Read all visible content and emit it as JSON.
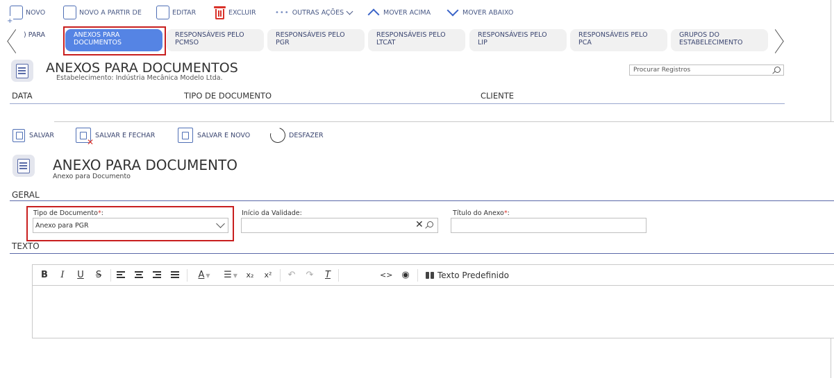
{
  "toolbar": {
    "novo": "NOVO",
    "novo_partir": "NOVO A PARTIR DE",
    "editar": "EDITAR",
    "excluir": "EXCLUIR",
    "outras_acoes": "OUTRAS AÇÕES",
    "mover_acima": "MOVER ACIMA",
    "mover_abaixo": "MOVER ABAIXO"
  },
  "tabs": [
    {
      "line1": ") PARA",
      "line2": "",
      "active": false
    },
    {
      "line1": "ANEXOS PARA",
      "line2": "DOCUMENTOS",
      "active": true
    },
    {
      "line1": "RESPONSÁVEIS PELO",
      "line2": "PCMSO",
      "active": false
    },
    {
      "line1": "RESPONSÁVEIS PELO",
      "line2": "PGR",
      "active": false
    },
    {
      "line1": "RESPONSÁVEIS PELO",
      "line2": "LTCAT",
      "active": false
    },
    {
      "line1": "RESPONSÁVEIS PELO",
      "line2": "LIP",
      "active": false
    },
    {
      "line1": "RESPONSÁVEIS PELO",
      "line2": "PCA",
      "active": false
    },
    {
      "line1": "GRUPOS DO",
      "line2": "ESTABELECIMENTO",
      "active": false
    }
  ],
  "list": {
    "title": "ANEXOS PARA DOCUMENTOS",
    "subtitle": "Estabelecimento: Indústria Mecânica Modelo Ltda.",
    "search_placeholder": "Procurar Registros",
    "columns": [
      "DATA",
      "TIPO DE DOCUMENTO",
      "CLIENTE"
    ]
  },
  "form_toolbar": {
    "salvar": "SALVAR",
    "salvar_fechar": "SALVAR E FECHAR",
    "salvar_novo": "SALVAR E NOVO",
    "desfazer": "DESFAZER"
  },
  "form": {
    "title": "ANEXO PARA DOCUMENTO",
    "subtitle": "Anexo para Documento",
    "section_geral": "GERAL",
    "section_texto": "TEXTO",
    "required_mark": "*",
    "tipo_label": "Tipo de Documento",
    "tipo_value": "Anexo para PGR",
    "inicio_label": "Início da Validade:",
    "titulo_label": "Título do Anexo",
    "colon": ":",
    "inicio_value": "",
    "titulo_value": ""
  },
  "editor": {
    "bold": "B",
    "italic": "I",
    "underline": "U",
    "strike": "S",
    "predefined": "Texto Predefinido",
    "content": ""
  },
  "colors": {
    "accent": "#5584e4",
    "highlight_border": "#c81e1e",
    "icon_blue": "#4f6fb5",
    "delete_red": "#d9322a"
  },
  "icons": [
    "new-doc-icon",
    "copy-doc-icon",
    "edit-icon",
    "trash-icon",
    "arrow-up-icon",
    "arrow-down-icon",
    "list-doc-icon",
    "search-icon",
    "save-icon",
    "save-close-icon",
    "save-new-icon",
    "undo-icon",
    "binoculars-icon"
  ]
}
